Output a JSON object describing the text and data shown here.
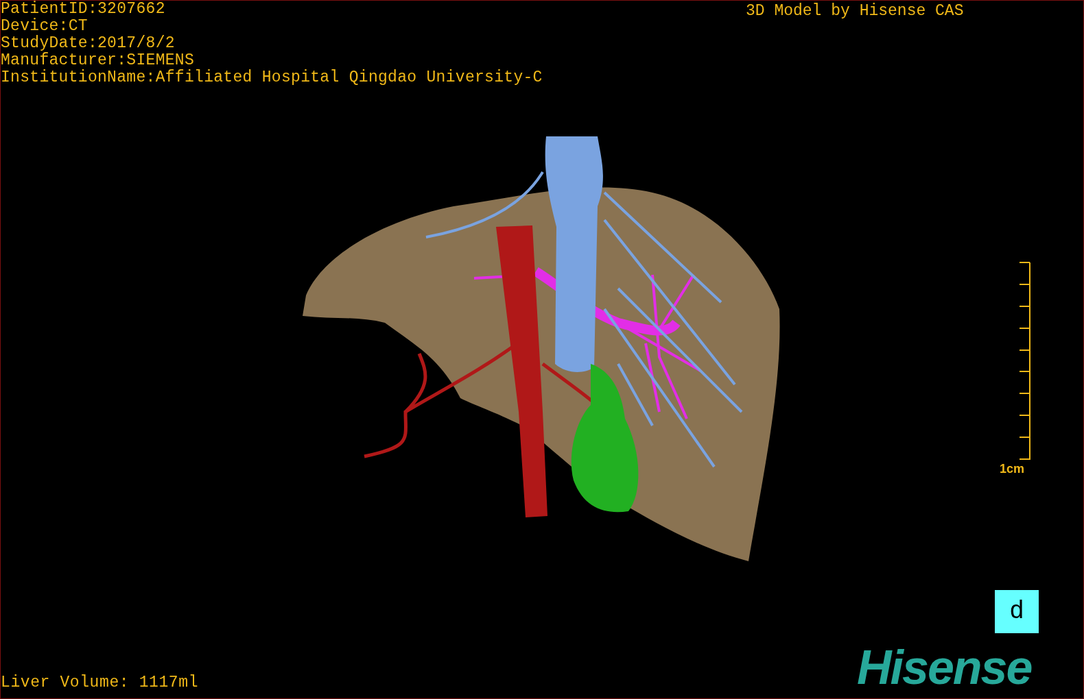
{
  "patient_info": [
    "PatientID:3207662",
    "Device:CT",
    "StudyDate:2017/8/2",
    "Manufacturer:SIEMENS",
    "InstitutionName:Affiliated Hospital Qingdao University-C"
  ],
  "header_right": "3D Model by Hisense CAS",
  "scale_bar": {
    "label": "1cm"
  },
  "orientation_marker": "d",
  "liver_volume": "Liver Volume: 1117ml",
  "logo": "Hisense"
}
